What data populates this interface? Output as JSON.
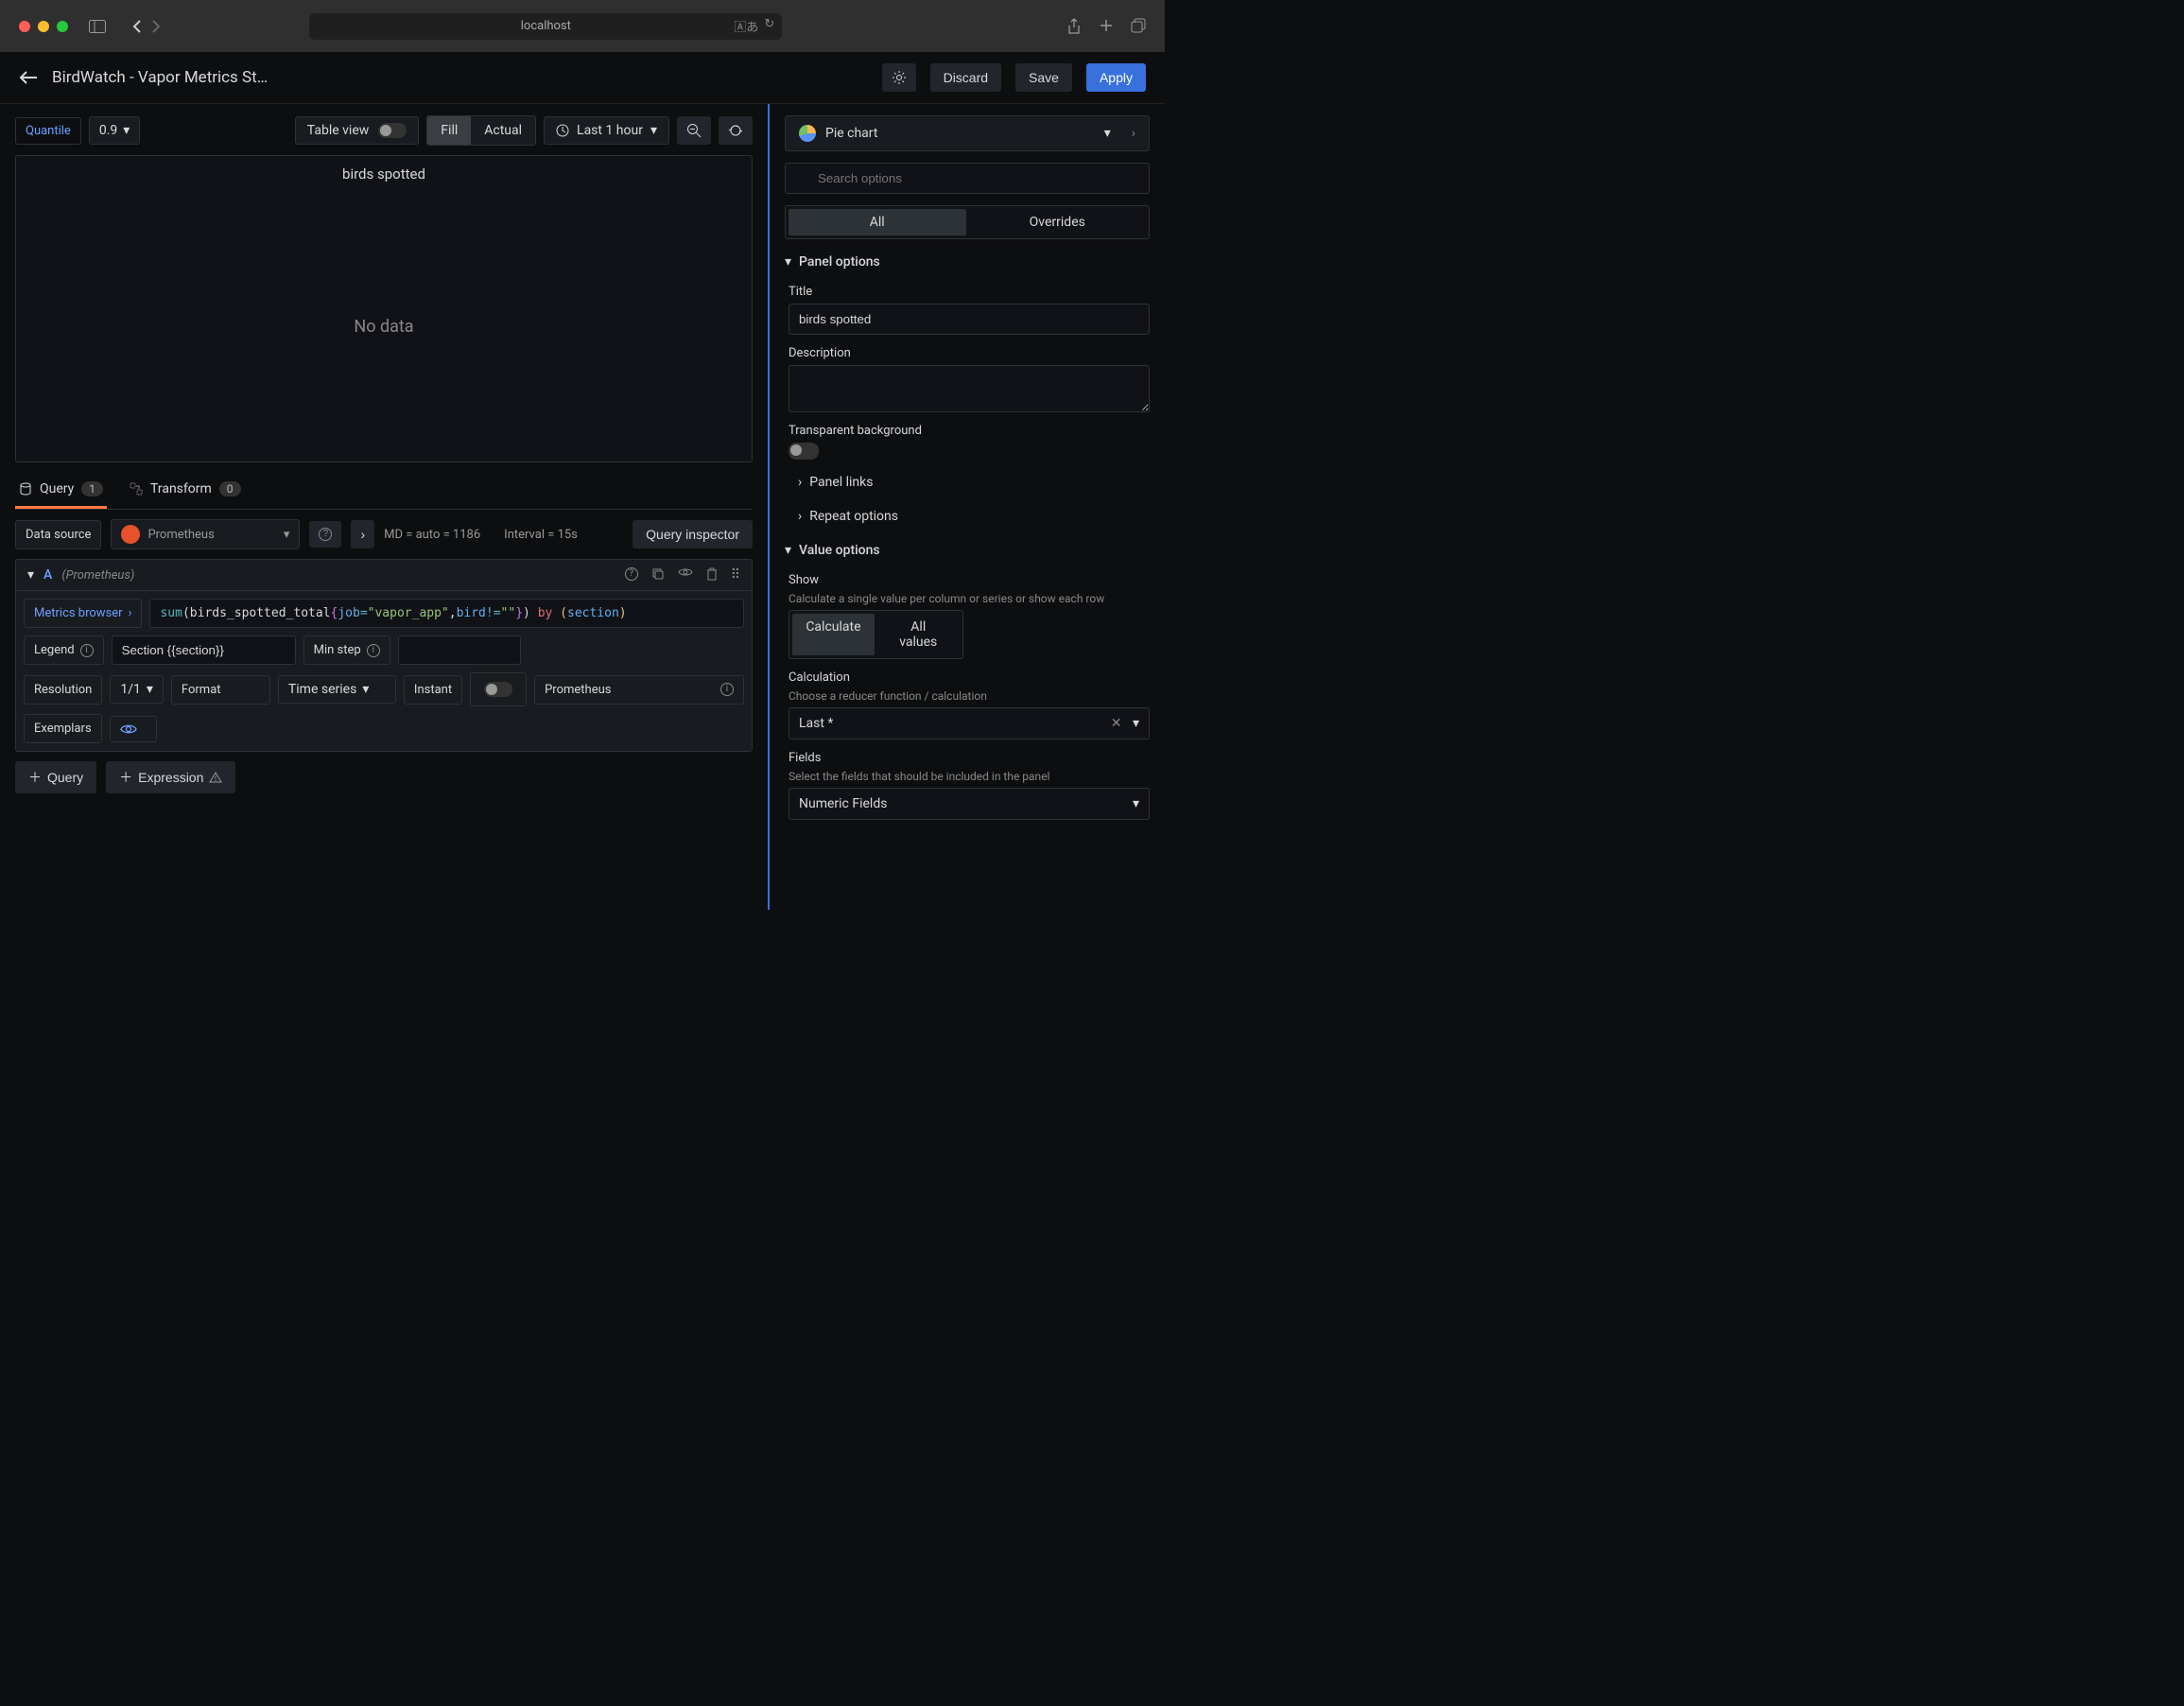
{
  "browser": {
    "url": "localhost"
  },
  "header": {
    "title": "BirdWatch - Vapor Metrics St…",
    "discard": "Discard",
    "save": "Save",
    "apply": "Apply"
  },
  "toolbar": {
    "quantile_label": "Quantile",
    "quantile_value": "0.9",
    "table_view": "Table view",
    "fill": "Fill",
    "actual": "Actual",
    "time_range": "Last 1 hour"
  },
  "viz": {
    "title": "birds spotted",
    "body": "No data"
  },
  "tabs": {
    "query": "Query",
    "query_count": "1",
    "transform": "Transform",
    "transform_count": "0"
  },
  "datasource": {
    "label": "Data source",
    "selected": "Prometheus",
    "md_info": "MD = auto = 1186",
    "interval_info": "Interval = 15s",
    "inspector": "Query inspector"
  },
  "query": {
    "letter": "A",
    "ds": "(Prometheus)",
    "metrics_browser": "Metrics browser",
    "legend_label": "Legend",
    "legend_value": "Section {{section}}",
    "min_step_label": "Min step",
    "resolution_label": "Resolution",
    "resolution_value": "1/1",
    "format_label": "Format",
    "format_value": "Time series",
    "instant_label": "Instant",
    "prom_label": "Prometheus",
    "exemplars_label": "Exemplars"
  },
  "actions": {
    "query": "Query",
    "expression": "Expression"
  },
  "right": {
    "viz_type": "Pie chart",
    "search_placeholder": "Search options",
    "tab_all": "All",
    "tab_overrides": "Overrides",
    "panel_options": "Panel options",
    "title_label": "Title",
    "title_value": "birds spotted",
    "description_label": "Description",
    "transparent_label": "Transparent background",
    "panel_links": "Panel links",
    "repeat_options": "Repeat options",
    "value_options": "Value options",
    "show_label": "Show",
    "show_hint": "Calculate a single value per column or series or show each row",
    "show_calculate": "Calculate",
    "show_all": "All values",
    "calculation_label": "Calculation",
    "calculation_hint": "Choose a reducer function / calculation",
    "calculation_value": "Last *",
    "fields_label": "Fields",
    "fields_hint": "Select the fields that should be included in the panel",
    "fields_value": "Numeric Fields"
  }
}
